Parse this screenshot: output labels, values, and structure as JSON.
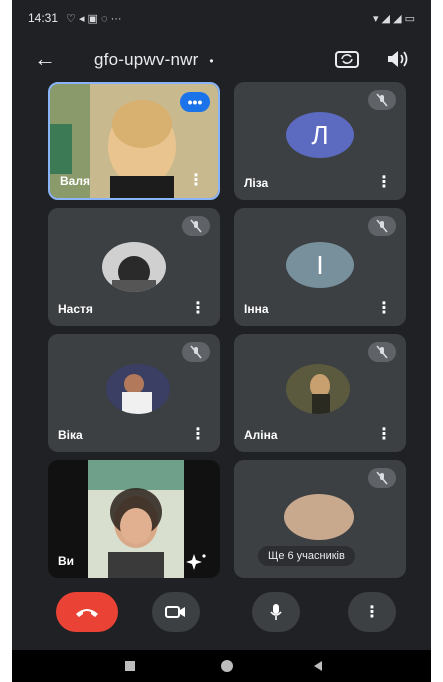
{
  "status_bar": {
    "time": "14:31",
    "left_icons": "♡ ◂ ▣ ◌ ···",
    "right_icons": "▾ ◢ ◢ ▭"
  },
  "top_bar": {
    "meeting_code": "gfo-upwv-nwr",
    "caret": "•"
  },
  "participants": [
    {
      "name": "Валя",
      "type": "video",
      "speaking_badge": "•••"
    },
    {
      "name": "Ліза",
      "type": "avatar",
      "letter": "Л",
      "avatar_color": "#5c6bc0"
    },
    {
      "name": "Настя",
      "type": "photo"
    },
    {
      "name": "Інна",
      "type": "avatar",
      "letter": "І",
      "avatar_color": "#78909c"
    },
    {
      "name": "Віка",
      "type": "photo"
    },
    {
      "name": "Аліна",
      "type": "photo"
    },
    {
      "name": "Ви",
      "type": "video"
    },
    {
      "name": "",
      "type": "more",
      "more_label": "Ще 6 учасників"
    }
  ],
  "controls": {
    "more_glyph": "⋮"
  },
  "colors": {
    "background": "#202124",
    "tile": "#3c4043",
    "end_call": "#ea4335",
    "active_border": "#8ab4f8"
  }
}
